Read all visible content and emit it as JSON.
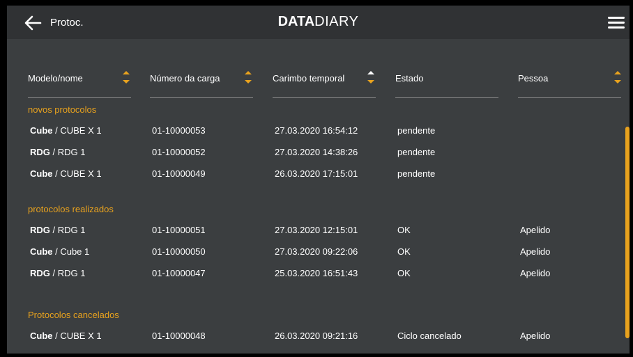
{
  "header": {
    "title": "Protoc.",
    "logo_bold": "DATA",
    "logo_thin": "DIARY"
  },
  "columns": [
    {
      "label": "Modelo/nome",
      "sort": "both"
    },
    {
      "label": "Número da carga",
      "sort": "both"
    },
    {
      "label": "Carimbo temporal",
      "sort": "both"
    },
    {
      "label": "Estado",
      "sort": "none"
    },
    {
      "label": "Pessoa",
      "sort": "both"
    }
  ],
  "sections": [
    {
      "title": "novos protocolos",
      "rows": [
        {
          "model": "Cube",
          "name": " / CUBE X 1",
          "load": "01-10000053",
          "timestamp": "27.03.2020 16:54:12",
          "state": "pendente",
          "person": ""
        },
        {
          "model": "RDG",
          "name": "  / RDG 1",
          "load": "01-10000052",
          "timestamp": "27.03.2020 14:38:26",
          "state": "pendente",
          "person": ""
        },
        {
          "model": "Cube",
          "name": " / CUBE X 1",
          "load": "01-10000049",
          "timestamp": "26.03.2020 17:15:01",
          "state": "pendente",
          "person": ""
        }
      ]
    },
    {
      "title": "protocolos realizados",
      "rows": [
        {
          "model": "RDG",
          "name": "  / RDG 1",
          "load": "01-10000051",
          "timestamp": "27.03.2020 12:15:01",
          "state": "OK",
          "person": "Apelido"
        },
        {
          "model": "Cube",
          "name": " / Cube 1",
          "load": "01-10000050",
          "timestamp": "27.03.2020 09:22:06",
          "state": "OK",
          "person": "Apelido"
        },
        {
          "model": "RDG",
          "name": "  / RDG 1",
          "load": "01-10000047",
          "timestamp": "25.03.2020 16:51:43",
          "state": "OK",
          "person": "Apelido"
        }
      ]
    },
    {
      "title": "Protocolos cancelados",
      "rows": [
        {
          "model": "Cube",
          "name": " / CUBE X 1",
          "load": "01-10000048",
          "timestamp": "26.03.2020 09:21:16",
          "state": "Ciclo cancelado",
          "person": "Apelido"
        }
      ]
    }
  ],
  "colors": {
    "accent": "#e8a21e",
    "background": "#3b3e40",
    "header": "#303234"
  }
}
